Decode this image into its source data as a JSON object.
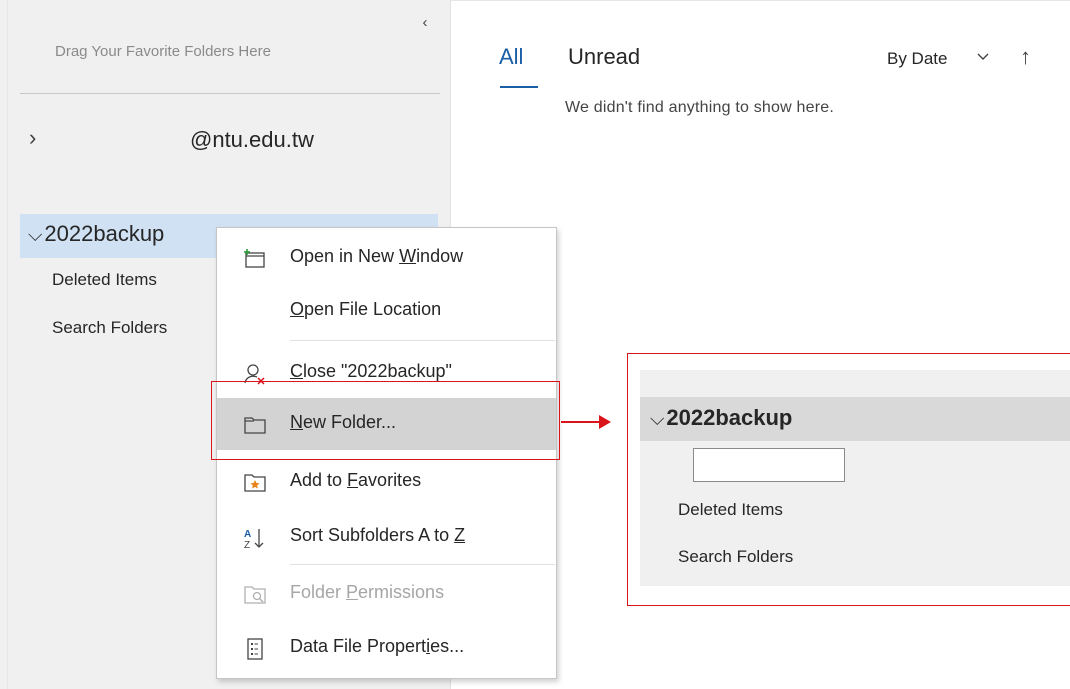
{
  "folder_pane": {
    "collapse_icon": "chevron-left-icon",
    "favorites_hint": "Drag Your Favorite Folders Here",
    "account": {
      "chevron": "›",
      "label": "@ntu.edu.tw"
    },
    "data_file": {
      "chevron": "v",
      "label": "2022backup"
    },
    "items": [
      {
        "label": "Deleted Items"
      },
      {
        "label": "Search Folders"
      }
    ]
  },
  "message_list": {
    "tabs": [
      {
        "label": "All",
        "active": true
      },
      {
        "label": "Unread",
        "active": false
      }
    ],
    "sort": {
      "label": "By Date",
      "chevron": "⌄",
      "direction_icon": "↑"
    },
    "empty_message": "We didn't find anything to show here."
  },
  "context_menu": {
    "items": [
      {
        "pre": "Open in New ",
        "key": "W",
        "post": "indow",
        "icon": "new-window-icon",
        "enabled": true
      },
      {
        "pre": "",
        "key": "O",
        "post": "pen File Location",
        "icon": "",
        "enabled": true
      },
      {
        "pre": "",
        "key": "C",
        "post": "lose \"2022backup\"",
        "icon": "close-account-icon",
        "enabled": true
      },
      {
        "pre": "",
        "key": "N",
        "post": "ew Folder...",
        "icon": "folder-icon",
        "enabled": true,
        "highlighted": true
      },
      {
        "pre": "Add to ",
        "key": "F",
        "post": "avorites",
        "icon": "add-favorite-icon",
        "enabled": true
      },
      {
        "pre": "Sort Subfolders A to ",
        "key": "Z",
        "post": "",
        "icon": "sort-az-icon",
        "enabled": true
      },
      {
        "pre": "Folder ",
        "key": "P",
        "post": "ermissions",
        "icon": "folder-permissions-icon",
        "enabled": false
      },
      {
        "pre": "Data File Propert",
        "key": "i",
        "post": "es...",
        "icon": "properties-icon",
        "enabled": true
      }
    ]
  },
  "zoom_inset": {
    "data_file": {
      "chevron": "v",
      "label": "2022backup"
    },
    "new_folder_input_value": "",
    "items": [
      {
        "label": "Deleted Items"
      },
      {
        "label": "Search Folders"
      }
    ]
  },
  "colors": {
    "accent": "#1a5ea6",
    "highlight_red": "#d9141a",
    "selected_row": "#cfe1f3",
    "hover_gray": "#d3d3d3"
  }
}
